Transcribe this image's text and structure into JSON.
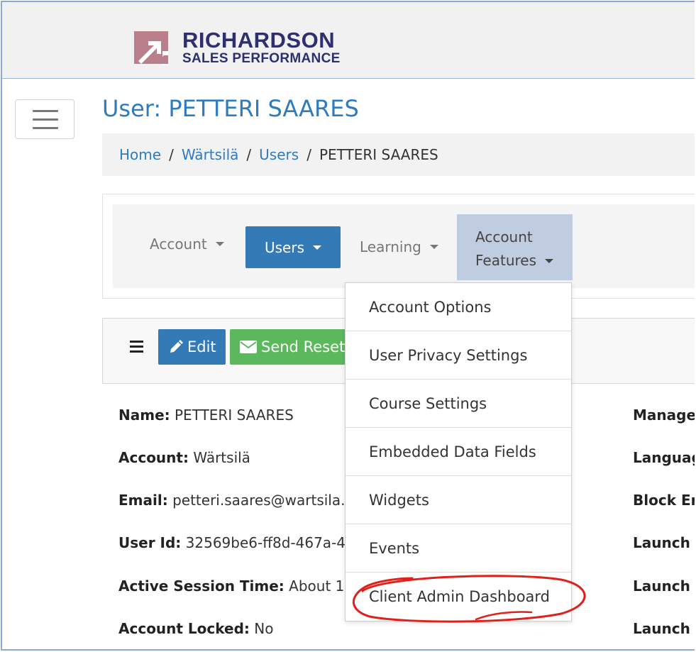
{
  "brand": {
    "line1": "RICHARDSON",
    "line2": "SALES PERFORMANCE",
    "colors": {
      "mark": "#b97f8b",
      "text": "#2e2f6e"
    }
  },
  "page": {
    "title": "User: PETTERI SAARES"
  },
  "breadcrumb": {
    "items": [
      "Home",
      "Wärtsilä",
      "Users"
    ],
    "current": "PETTERI SAARES",
    "separator": "/"
  },
  "nav": {
    "account": "Account",
    "users": "Users",
    "learning": "Learning",
    "features_line1": "Account",
    "features_line2": "Features"
  },
  "actions": {
    "edit": "Edit",
    "send_reset": "Send Reset"
  },
  "details": {
    "name_label": "Name:",
    "name_value": "PETTERI SAARES",
    "account_label": "Account:",
    "account_value": "Wärtsilä",
    "email_label": "Email:",
    "email_value": "petteri.saares@wartsila.c",
    "userid_label": "User Id:",
    "userid_value": "32569be6-ff8d-467a-4",
    "session_label": "Active Session Time:",
    "session_value": "About 1",
    "locked_label": "Account Locked:",
    "locked_value": "No"
  },
  "right_labels": [
    "Manage",
    "Languag",
    "Block Er",
    "Launch",
    "Launch",
    "Launch"
  ],
  "dropdown": {
    "items": [
      "Account Options",
      "User Privacy Settings",
      "Course Settings",
      "Embedded Data Fields",
      "Widgets",
      "Events",
      "Client Admin Dashboard"
    ]
  },
  "colors": {
    "link": "#2f7bbf",
    "primary": "#337ab7",
    "success": "#5cb85c",
    "annotation": "#e0201b"
  }
}
